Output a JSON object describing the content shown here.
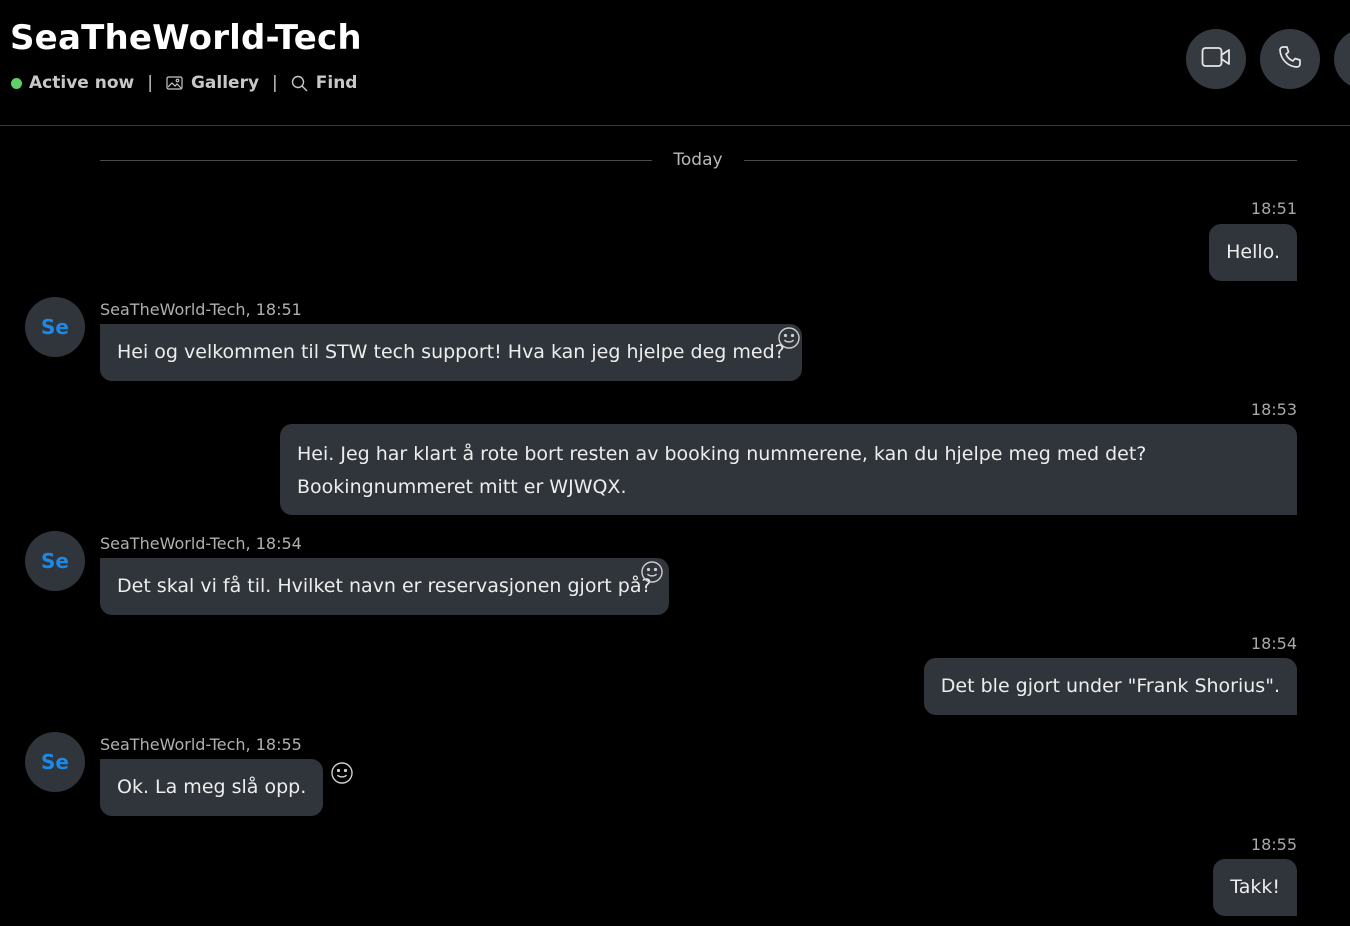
{
  "header": {
    "title": "SeaTheWorld-Tech",
    "status": "Active now",
    "separator": "|",
    "gallery_label": "Gallery",
    "find_label": "Find",
    "status_color": "#5fd068",
    "icons": [
      "video-call-icon",
      "phone-call-icon",
      "more-icon"
    ]
  },
  "date_divider": "Today",
  "messages": [
    {
      "direction": "outgoing",
      "time": "18:51",
      "text": "Hello."
    },
    {
      "direction": "incoming",
      "avatar": "Se",
      "sender_line": "SeaTheWorld-Tech, 18:51",
      "text": "Hei og velkommen til STW tech support! Hva kan jeg hjelpe deg med?"
    },
    {
      "direction": "outgoing",
      "time": "18:53",
      "text": "Hei. Jeg har klart å rote bort resten av booking nummerene, kan du hjelpe meg med det? Bookingnummeret mitt er WJWQX."
    },
    {
      "direction": "incoming",
      "avatar": "Se",
      "sender_line": "SeaTheWorld-Tech, 18:54",
      "text": "Det skal vi få til. Hvilket navn er reservasjonen gjort på?"
    },
    {
      "direction": "outgoing",
      "time": "18:54",
      "text": "Det ble gjort under \"Frank Shorius\"."
    },
    {
      "direction": "incoming",
      "avatar": "Se",
      "sender_line": "SeaTheWorld-Tech, 18:55",
      "text": "Ok. La meg slå opp."
    },
    {
      "direction": "outgoing",
      "time": "18:55",
      "text": "Takk!"
    }
  ],
  "colors": {
    "background": "#000000",
    "bubble": "#2f353b",
    "avatar_text": "#1e88e5"
  }
}
